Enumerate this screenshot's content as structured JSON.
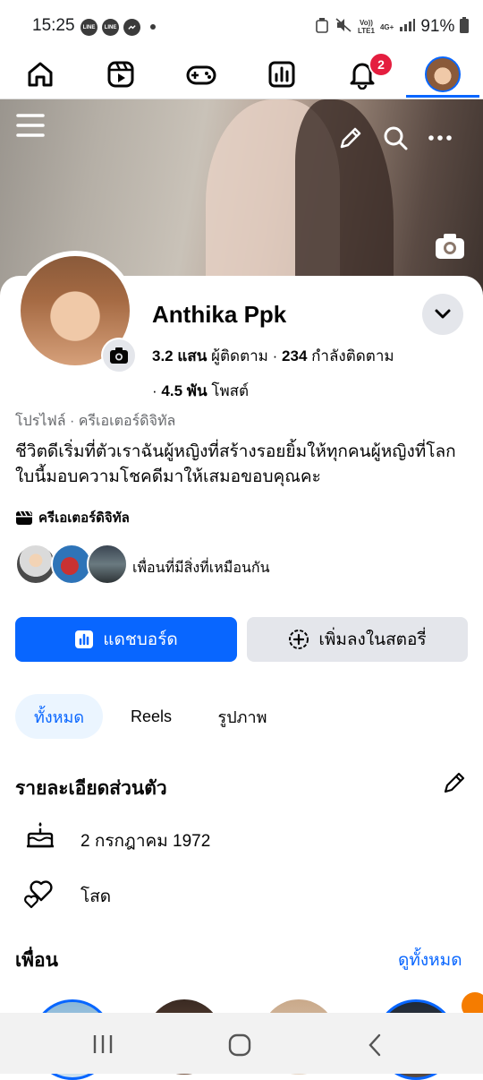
{
  "status_bar": {
    "time": "15:25",
    "app_icons": [
      "LINE",
      "LINE"
    ],
    "network_top": "Vo))",
    "network_bottom": "LTE1",
    "network_type": "4G+",
    "battery": "91%"
  },
  "nav": {
    "items": [
      "home-icon",
      "reels-icon",
      "gaming-icon",
      "dashboard-icon",
      "notifications-icon",
      "profile-avatar"
    ],
    "notification_count": "2",
    "active_index": 5
  },
  "profile": {
    "name": "Anthika Ppk",
    "followers_count": "3.2 แสน",
    "followers_label": "ผู้ติดตาม",
    "separator": "·",
    "following_count": "234",
    "following_label": "กำลังติดตาม",
    "posts_prefix": "·",
    "posts_count": "4.5 พัน",
    "posts_label": "โพสต์",
    "category": "โปรไฟล์ · ครีเอเตอร์ดิจิทัล",
    "bio": "ชีวิตดีเริ่มที่ตัวเราฉันผู้หญิงที่สร้างรอยยิ้มให้ทุกคนผู้หญิงที่โลกใบนี้มอบความโชคดีมาให้เสมอขอบคุณคะ",
    "creator_label": "ครีเอเตอร์ดิจิทัล",
    "mutual_text": "เพื่อนที่มีสิ่งที่เหมือนกัน"
  },
  "actions": {
    "dashboard_label": "แดชบอร์ด",
    "add_story_label": "เพิ่มลงในสตอรี่"
  },
  "tabs": [
    "ทั้งหมด",
    "Reels",
    "รูปภาพ"
  ],
  "details": {
    "title": "รายละเอียดส่วนตัว",
    "birthday": "2 กรกฎาคม  1972",
    "relationship": "โสด"
  },
  "friends": {
    "title": "เพื่อน",
    "see_all": "ดูทั้งหมด"
  },
  "colors": {
    "accent": "#0866ff",
    "badge": "#e41e3f",
    "secondary_bg": "#e4e6eb"
  }
}
